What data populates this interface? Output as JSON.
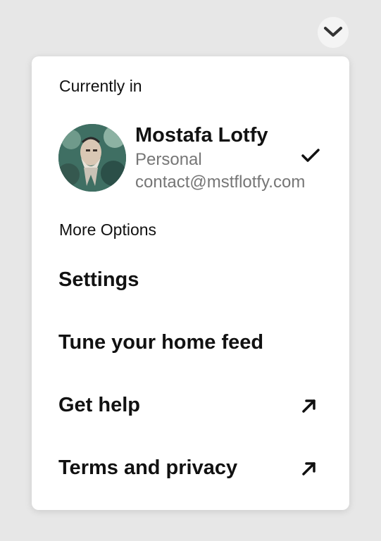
{
  "header": {
    "toggle_icon": "chevron-down-icon"
  },
  "menu": {
    "current_section_label": "Currently in",
    "account": {
      "name": "Mostafa Lotfy",
      "type": "Personal",
      "email": "contact@mstflotfy.com",
      "selected_icon": "checkmark-icon"
    },
    "more_section_label": "More Options",
    "items": [
      {
        "label": "Settings"
      },
      {
        "label": "Tune your home feed"
      },
      {
        "label": "Get help",
        "icon": "external-link-arrow-icon"
      },
      {
        "label": "Terms and privacy",
        "icon": "external-link-arrow-icon"
      }
    ]
  },
  "colors": {
    "background": "#e7e7e7",
    "card": "#ffffff",
    "primary_text": "#111111",
    "secondary_text": "#767676"
  }
}
